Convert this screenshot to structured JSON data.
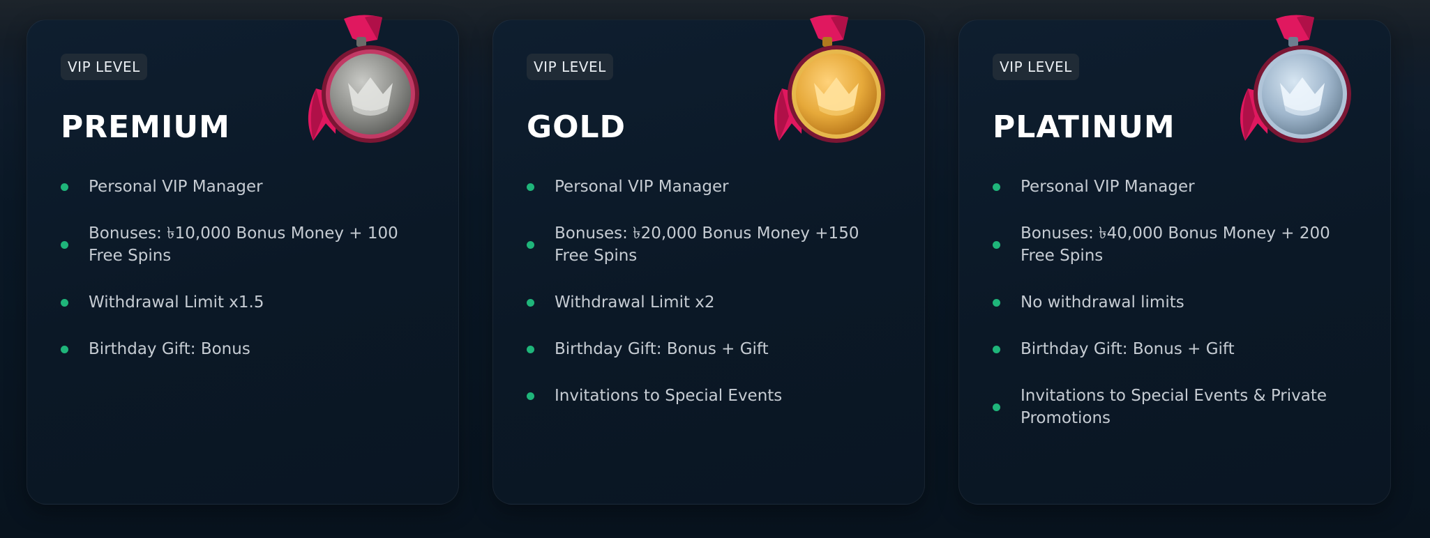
{
  "cards": [
    {
      "badge": "VIP LEVEL",
      "title": "PREMIUM",
      "medal": "silver-crown-medal-icon",
      "features": [
        "Personal VIP Manager",
        "Bonuses: ৳10,000 Bonus Money + 100 Free Spins",
        "Withdrawal Limit x1.5",
        "Birthday Gift: Bonus"
      ]
    },
    {
      "badge": "VIP LEVEL",
      "title": "GOLD",
      "medal": "gold-crown-medal-icon",
      "features": [
        "Personal VIP Manager",
        "Bonuses: ৳20,000 Bonus Money +150 Free Spins",
        "Withdrawal Limit x2",
        "Birthday Gift: Bonus + Gift",
        "Invitations to Special Events"
      ]
    },
    {
      "badge": "VIP LEVEL",
      "title": "PLATINUM",
      "medal": "platinum-crown-medal-icon",
      "features": [
        "Personal VIP Manager",
        "Bonuses: ৳40,000 Bonus Money + 200 Free Spins",
        "No withdrawal limits",
        "Birthday Gift: Bonus + Gift",
        "Invitations to Special Events & Private Promotions"
      ]
    }
  ],
  "colors": {
    "bullet": "#1fb57a",
    "ribbon": "#e0185f",
    "silver": "#a6a7a4",
    "gold": "#e6a93a",
    "platinum": "#9fb6cc"
  }
}
